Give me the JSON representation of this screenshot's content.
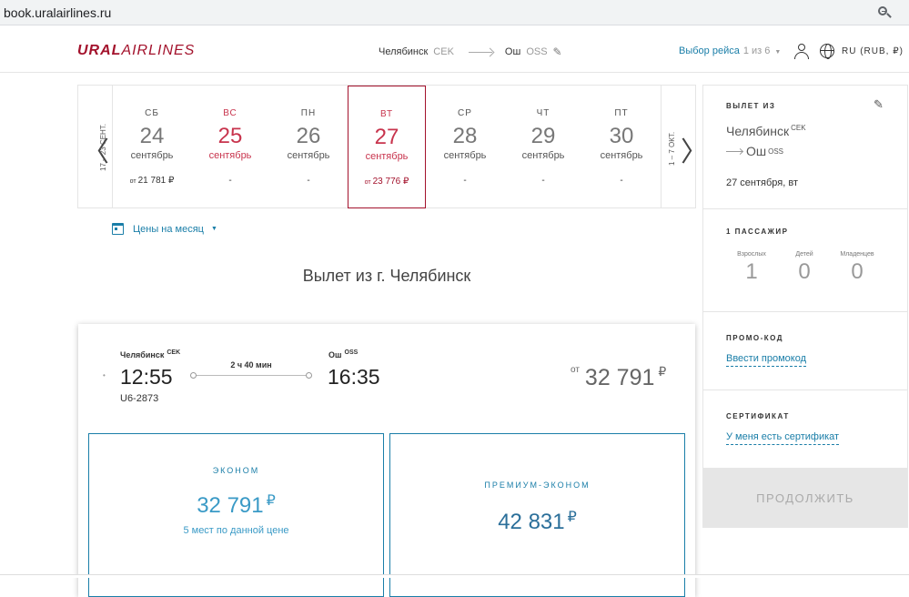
{
  "browser": {
    "url": "book.uralairlines.ru"
  },
  "header": {
    "logo_bold": "URAL",
    "logo_rest": "AIRLINES",
    "route": {
      "from": "Челябинск",
      "from_code": "CEK",
      "to": "Ош",
      "to_code": "OSS"
    },
    "flight_select": {
      "label": "Выбор рейса",
      "count": "1 из 6"
    },
    "language": "RU (RUB, ₽)"
  },
  "date_strip": {
    "prev_range": "17 – 23 СЕНТ.",
    "next_range": "1 – 7 ОКТ.",
    "days": [
      {
        "weekday": "СБ",
        "num": "24",
        "month": "сентябрь",
        "price_prefix": "от",
        "price": "21 781 ₽",
        "holiday": false,
        "selected": false
      },
      {
        "weekday": "ВС",
        "num": "25",
        "month": "сентябрь",
        "price_prefix": "",
        "price": "-",
        "holiday": true,
        "selected": false
      },
      {
        "weekday": "ПН",
        "num": "26",
        "month": "сентябрь",
        "price_prefix": "",
        "price": "-",
        "holiday": false,
        "selected": false
      },
      {
        "weekday": "ВТ",
        "num": "27",
        "month": "сентябрь",
        "price_prefix": "от",
        "price": "23 776 ₽",
        "holiday": false,
        "selected": true
      },
      {
        "weekday": "СР",
        "num": "28",
        "month": "сентябрь",
        "price_prefix": "",
        "price": "-",
        "holiday": false,
        "selected": false
      },
      {
        "weekday": "ЧТ",
        "num": "29",
        "month": "сентябрь",
        "price_prefix": "",
        "price": "-",
        "holiday": false,
        "selected": false
      },
      {
        "weekday": "ПТ",
        "num": "30",
        "month": "сентябрь",
        "price_prefix": "",
        "price": "-",
        "holiday": false,
        "selected": false
      }
    ]
  },
  "month_prices_link": "Цены на месяц",
  "departure_title": "Вылет из г. Челябинск",
  "flight": {
    "from_city": "Челябинск",
    "from_code": "CEK",
    "to_city": "Ош",
    "to_code": "OSS",
    "dep_time": "12:55",
    "arr_time": "16:35",
    "duration": "2 ч 40 мин",
    "number": "U6-2873",
    "price_prefix": "от",
    "price": "32 791",
    "currency": "₽"
  },
  "fares": {
    "economy": {
      "title": "ЭКОНОМ",
      "price": "32 791",
      "currency": "₽",
      "note": "5 мест по данной цене"
    },
    "premium": {
      "title": "ПРЕМИУМ-ЭКОНОМ",
      "price": "42 831",
      "currency": "₽"
    }
  },
  "sidebar": {
    "departure_label": "ВЫЛЕТ ИЗ",
    "from_city": "Челябинск",
    "from_code": "CEK",
    "to_city": "Ош",
    "to_code": "OSS",
    "date": "27 сентября, вт",
    "passengers_label": "1 ПАССАЖИР",
    "adults_label": "Взрослых",
    "adults": "1",
    "children_label": "Детей",
    "children": "0",
    "infants_label": "Младенцев",
    "infants": "0",
    "promo_label": "ПРОМО-КОД",
    "promo_link": "Ввести промокод",
    "cert_label": "СЕРТИФИКАТ",
    "cert_link": "У меня есть сертификат",
    "continue": "ПРОДОЛЖИТЬ"
  },
  "icons": {
    "zoom": "zoom-icon",
    "pencil": "pencil-icon",
    "user": "user-icon",
    "globe": "globe-icon",
    "calendar": "calendar-icon"
  },
  "colors": {
    "brand": "#a3122c",
    "link": "#1a7ea8",
    "holiday": "#c8344d"
  }
}
